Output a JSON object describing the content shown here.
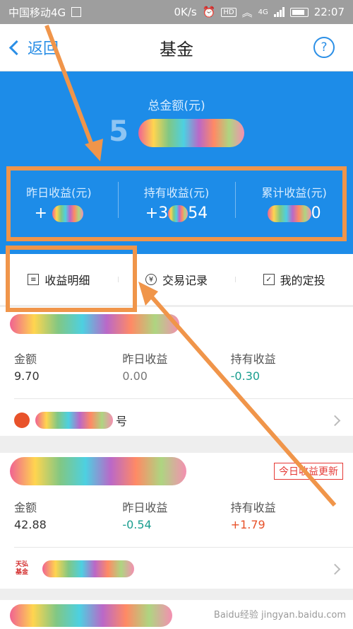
{
  "status_bar": {
    "carrier": "中国移动4G",
    "speed": "0K/s",
    "hd": "HD",
    "network": "4G",
    "time": "22:07"
  },
  "nav": {
    "back_label": "返回",
    "title": "基金",
    "help_symbol": "?"
  },
  "summary": {
    "total_label": "总金额(元)",
    "total_value": "5",
    "metrics": [
      {
        "label": "昨日收益(元)",
        "value": "+"
      },
      {
        "label": "持有收益(元)",
        "value": "+3",
        "suffix": "54"
      },
      {
        "label": "累计收益(元)",
        "value": "",
        "suffix": "0"
      }
    ]
  },
  "tabs": [
    {
      "label": "收益明细",
      "icon": "document-icon"
    },
    {
      "label": "交易记录",
      "icon": "yen-icon"
    },
    {
      "label": "我的定投",
      "icon": "calendar-icon"
    }
  ],
  "funds": [
    {
      "fields": [
        {
          "label": "金额",
          "value": "9.70"
        },
        {
          "label": "昨日收益",
          "value": "0.00"
        },
        {
          "label": "持有收益",
          "value": "-0.30"
        }
      ],
      "foot_text": "号"
    },
    {
      "badge": "今日收益更新",
      "fields": [
        {
          "label": "金额",
          "value": "42.88"
        },
        {
          "label": "昨日收益",
          "value": "-0.54"
        },
        {
          "label": "持有收益",
          "value": "+1.79"
        }
      ],
      "logo_text": "天弘基金"
    }
  ],
  "watermark": "Baidu经验 jingyan.baidu.com",
  "colors": {
    "accent": "#1d8ce8",
    "annotation": "#f0954a",
    "negative": "#1a9e8f",
    "positive": "#e8522a"
  }
}
